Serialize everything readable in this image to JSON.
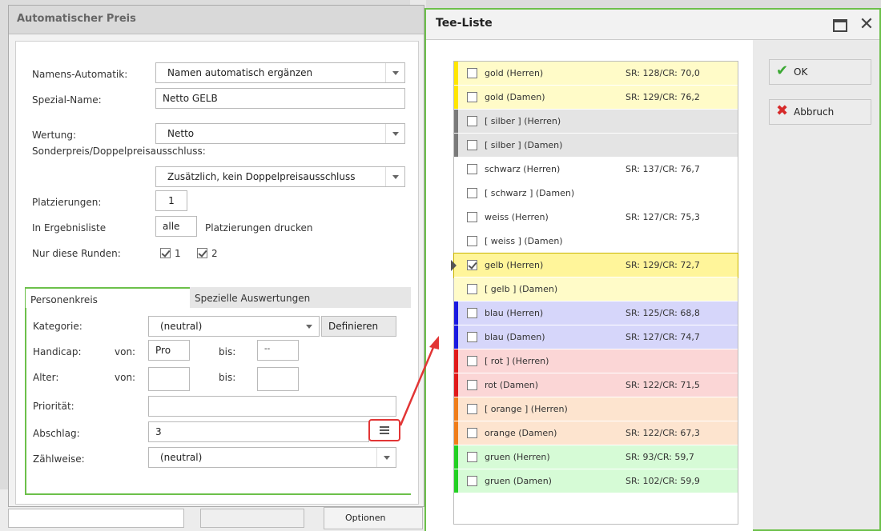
{
  "left_dialog": {
    "title": "Automatischer Preis",
    "namens_label": "Namens-Automatik:",
    "namens_value": "Namen automatisch ergänzen",
    "spezial_label": "Spezial-Name:",
    "spezial_value": "Netto GELB",
    "wertung_label": "Wertung:",
    "wertung_value": "Netto",
    "sonder_label": "Sonderpreis/Doppelpreisausschluss:",
    "sonder_value": "Zusätzlich, kein Doppelpreisausschluss",
    "platz_label": "Platzierungen:",
    "platz_value": "1",
    "ergebnis_label": "In Ergebnisliste",
    "ergebnis_value": "alle",
    "ergebnis_suffix": "Platzierungen drucken",
    "runden_label": "Nur diese Runden:",
    "runden": [
      {
        "label": "1",
        "checked": true
      },
      {
        "label": "2",
        "checked": true
      }
    ],
    "tabs": {
      "active": "Personenkreis",
      "other": "Spezielle Auswertungen"
    },
    "kategorie_label": "Kategorie:",
    "kategorie_value": "(neutral)",
    "definieren_label": "Definieren",
    "handicap_label": "Handicap:",
    "von_label": "von:",
    "bis_label": "bis:",
    "handicap_von": "Pro",
    "handicap_bis": "--",
    "alter_label": "Alter:",
    "alter_von": "",
    "alter_bis": "",
    "prioritaet_label": "Priorität:",
    "prioritaet_value": "",
    "abschlag_label": "Abschlag:",
    "abschlag_value": "3",
    "zaehlweise_label": "Zählweise:",
    "zaehlweise_value": "(neutral)"
  },
  "background": {
    "optionen_label": "Optionen"
  },
  "tee_dialog": {
    "title": "Tee-Liste",
    "ok_label": "OK",
    "cancel_label": "Abbruch",
    "rows": [
      {
        "name": "gold (Herren)",
        "sr": "SR: 128/CR: 70,0",
        "bg": "#fffbc8",
        "stripe": "#ffe600",
        "checked": false
      },
      {
        "name": "gold (Damen)",
        "sr": "SR: 129/CR: 76,2",
        "bg": "#fffbc8",
        "stripe": "#ffe600",
        "checked": false
      },
      {
        "name": "[ silber ] (Herren)",
        "sr": "",
        "bg": "#e4e4e4",
        "stripe": "#7a7a7a",
        "checked": false
      },
      {
        "name": "[ silber ] (Damen)",
        "sr": "",
        "bg": "#e4e4e4",
        "stripe": "#7a7a7a",
        "checked": false
      },
      {
        "name": "schwarz (Herren)",
        "sr": "SR: 137/CR: 76,7",
        "bg": "#ffffff",
        "stripe": "#ffffff",
        "checked": false
      },
      {
        "name": "[ schwarz ] (Damen)",
        "sr": "",
        "bg": "#ffffff",
        "stripe": "#ffffff",
        "checked": false
      },
      {
        "name": "weiss (Herren)",
        "sr": "SR: 127/CR: 75,3",
        "bg": "#ffffff",
        "stripe": "#ffffff",
        "checked": false
      },
      {
        "name": "[ weiss ] (Damen)",
        "sr": "",
        "bg": "#ffffff",
        "stripe": "#ffffff",
        "checked": false
      },
      {
        "name": "gelb (Herren)",
        "sr": "SR: 129/CR: 72,7",
        "bg": "#fff59a",
        "stripe": "#fff59a",
        "checked": true,
        "selected": true
      },
      {
        "name": "[ gelb ] (Damen)",
        "sr": "",
        "bg": "#fffbc8",
        "stripe": "#fffbc8",
        "checked": false
      },
      {
        "name": "blau (Herren)",
        "sr": "SR: 125/CR: 68,8",
        "bg": "#d6d6fa",
        "stripe": "#1a1ae0",
        "checked": false
      },
      {
        "name": "blau (Damen)",
        "sr": "SR: 127/CR: 74,7",
        "bg": "#d6d6fa",
        "stripe": "#1a1ae0",
        "checked": false
      },
      {
        "name": "[ rot ] (Herren)",
        "sr": "",
        "bg": "#fbd6d6",
        "stripe": "#e01a1a",
        "checked": false
      },
      {
        "name": "rot (Damen)",
        "sr": "SR: 122/CR: 71,5",
        "bg": "#fbd6d6",
        "stripe": "#e01a1a",
        "checked": false
      },
      {
        "name": "[ orange ] (Herren)",
        "sr": "",
        "bg": "#fde4cf",
        "stripe": "#f07d1a",
        "checked": false
      },
      {
        "name": "orange (Damen)",
        "sr": "SR: 122/CR: 67,3",
        "bg": "#fde4cf",
        "stripe": "#f07d1a",
        "checked": false
      },
      {
        "name": "gruen (Herren)",
        "sr": "SR: 93/CR: 59,7",
        "bg": "#d6fbd6",
        "stripe": "#22d022",
        "checked": false
      },
      {
        "name": "gruen (Damen)",
        "sr": "SR: 102/CR: 59,9",
        "bg": "#d6fbd6",
        "stripe": "#22d022",
        "checked": false
      }
    ]
  },
  "colors": {
    "accent_green": "#6cc04a",
    "annotation_red": "#e23535"
  }
}
